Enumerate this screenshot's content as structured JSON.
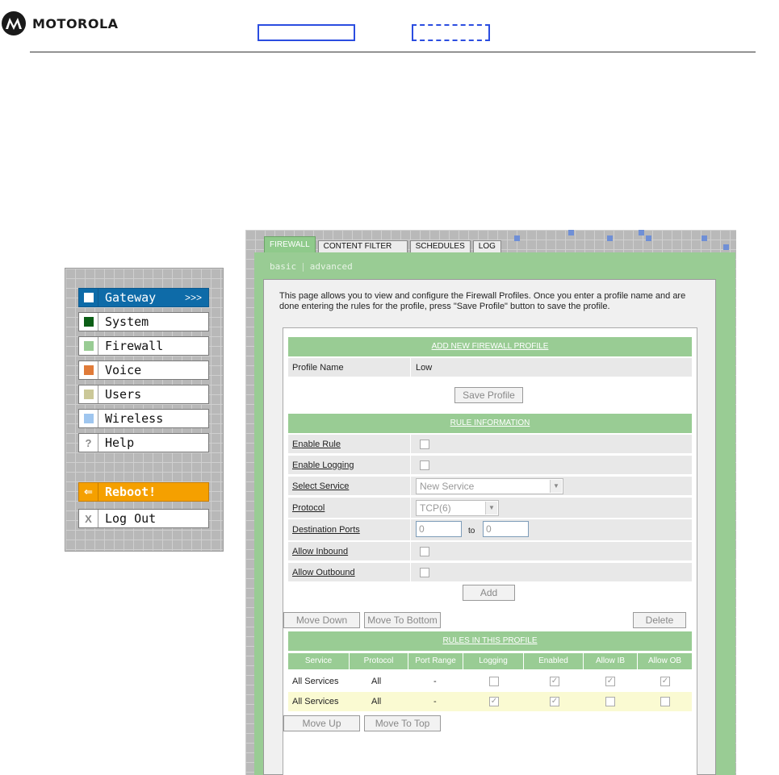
{
  "header": {
    "brand": "MOTOROLA"
  },
  "nav": {
    "items": [
      {
        "label": "Gateway",
        "arrow": ">>>",
        "color": "#ffffff"
      },
      {
        "label": "System",
        "color": "#0b5e16"
      },
      {
        "label": "Firewall",
        "color": "#99cc94"
      },
      {
        "label": "Voice",
        "color": "#e07b39"
      },
      {
        "label": "Users",
        "color": "#cbc898"
      },
      {
        "label": "Wireless",
        "color": "#9fc6ef"
      },
      {
        "label": "Help",
        "icon": "?"
      }
    ],
    "reboot": {
      "label": "Reboot!",
      "icon": "⇐"
    },
    "logout": {
      "label": "Log Out",
      "icon": "X"
    }
  },
  "tabs": [
    "FIREWALL",
    "CONTENT FILTER",
    "SCHEDULES",
    "LOG"
  ],
  "subtabs": {
    "basic": "basic",
    "sep": "|",
    "advanced": "advanced"
  },
  "intro": "This page allows you to view and configure the Firewall Profiles. Once you enter a profile name and are done entering the rules for the profile, press \"Save Profile\" button to save the profile.",
  "add_profile": {
    "title": "ADD NEW FIREWALL PROFILE",
    "profile_name_label": "Profile Name",
    "profile_name_value": "Low",
    "save_button": "Save Profile"
  },
  "rule_info": {
    "title": "RULE INFORMATION",
    "enable_rule": "Enable Rule",
    "enable_logging": "Enable Logging",
    "select_service": "Select Service",
    "service_value": "New Service",
    "protocol": "Protocol",
    "protocol_value": "TCP(6)",
    "destination_ports": "Destination Ports",
    "port_from": "0",
    "port_to_label": "to",
    "port_to": "0",
    "allow_inbound": "Allow Inbound",
    "allow_outbound": "Allow Outbound",
    "add_button": "Add"
  },
  "list_buttons": {
    "move_down": "Move Down",
    "move_to_bottom": "Move To Bottom",
    "delete": "Delete",
    "move_up": "Move Up",
    "move_to_top": "Move To Top"
  },
  "rules_table": {
    "title": "RULES IN THIS PROFILE",
    "columns": [
      "Service",
      "Protocol",
      "Port Range",
      "Logging",
      "Enabled",
      "Allow IB",
      "Allow OB"
    ],
    "rows": [
      {
        "service": "All Services",
        "protocol": "All",
        "port_range": "-",
        "logging": false,
        "enabled": true,
        "allow_ib": true,
        "allow_ob": true
      },
      {
        "service": "All Services",
        "protocol": "All",
        "port_range": "-",
        "logging": true,
        "enabled": true,
        "allow_ib": false,
        "allow_ob": false
      }
    ]
  }
}
